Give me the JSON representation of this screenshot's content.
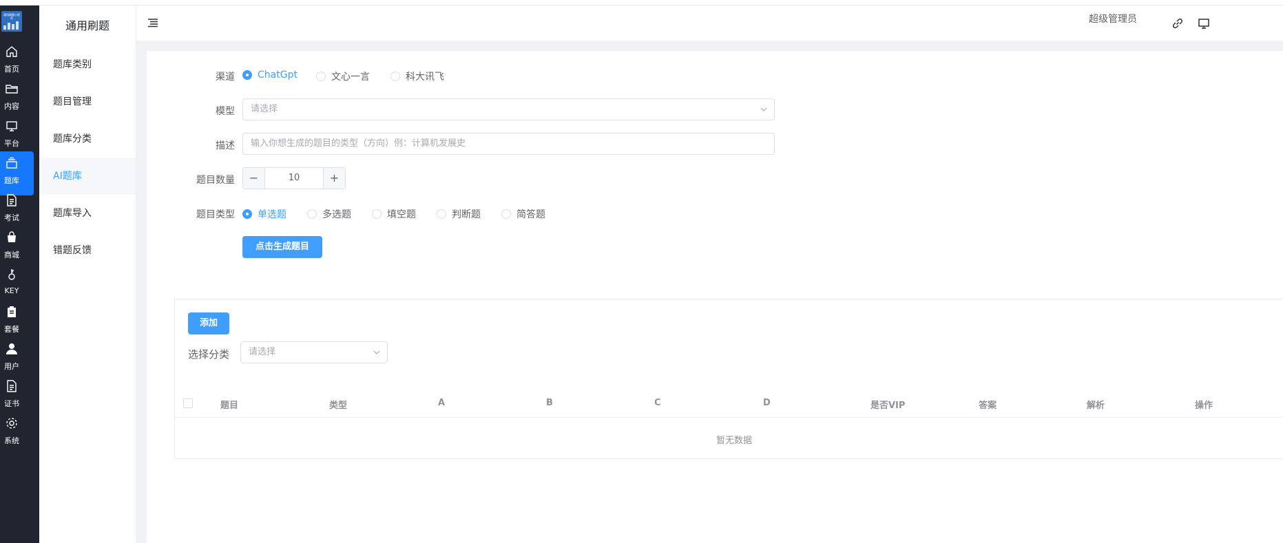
{
  "logo_text": "通用刷题小程序",
  "rail": [
    {
      "label": "首页",
      "icon": "home-icon"
    },
    {
      "label": "内容",
      "icon": "folder-icon"
    },
    {
      "label": "平台",
      "icon": "monitor-icon"
    },
    {
      "label": "题库",
      "icon": "stack-icon",
      "active": true
    },
    {
      "label": "考试",
      "icon": "document-icon"
    },
    {
      "label": "商城",
      "icon": "bag-icon"
    },
    {
      "label": "KEY",
      "icon": "key-icon"
    },
    {
      "label": "套餐",
      "icon": "clipboard-icon"
    },
    {
      "label": "用户",
      "icon": "user-icon"
    },
    {
      "label": "证书",
      "icon": "certificate-icon"
    },
    {
      "label": "系统",
      "icon": "gear-icon"
    }
  ],
  "submenu": {
    "title": "通用刷题",
    "items": [
      {
        "label": "题库类别"
      },
      {
        "label": "题目管理"
      },
      {
        "label": "题库分类"
      },
      {
        "label": "AI题库",
        "active": true
      },
      {
        "label": "题库导入"
      },
      {
        "label": "错题反馈"
      }
    ]
  },
  "header": {
    "user": "超级管理员",
    "icons": [
      "menu-icon",
      "link-icon",
      "monitor-icon"
    ]
  },
  "form": {
    "channel_label": "渠道",
    "channels": [
      "ChatGpt",
      "文心一言",
      "科大讯飞"
    ],
    "channel_selected": "ChatGpt",
    "model_label": "模型",
    "model_placeholder": "请选择",
    "desc_label": "描述",
    "desc_placeholder": "输入你想生成的题目的类型（方向）例：计算机发展史",
    "count_label": "题目数量",
    "count_value": "10",
    "count_minus": "−",
    "count_plus": "+",
    "type_label": "题目类型",
    "types": [
      "单选题",
      "多选题",
      "填空题",
      "判断题",
      "简答题"
    ],
    "type_selected": "单选题",
    "generate_button": "点击生成题目"
  },
  "table_panel": {
    "add_button": "添加",
    "filter_label": "选择分类",
    "filter_placeholder": "请选择",
    "columns": [
      "题目",
      "类型",
      "A",
      "B",
      "C",
      "D",
      "是否VIP",
      "答案",
      "解析",
      "操作"
    ],
    "empty_text": "暂无数据"
  },
  "colors": {
    "primary": "#409eff",
    "rail_bg": "#20252f",
    "rail_active": "#1677ff"
  }
}
